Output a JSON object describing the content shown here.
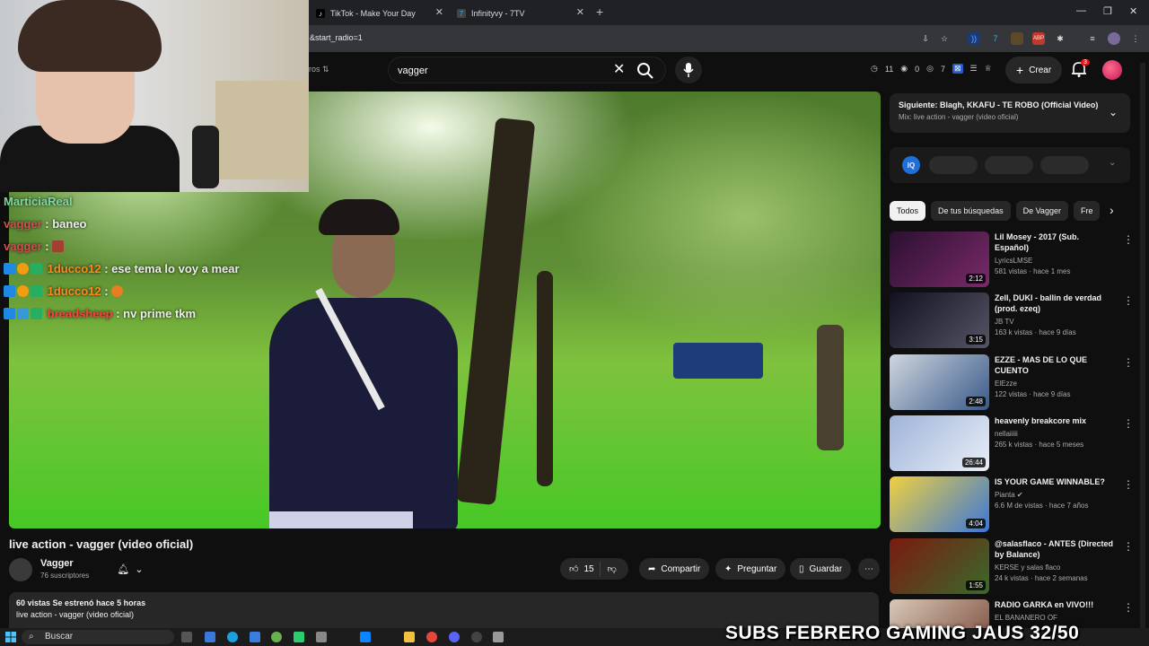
{
  "browser": {
    "tabs": [
      {
        "label": "TikTok - Make Your Day",
        "icon": "tiktok-icon"
      },
      {
        "label": "Infinityvy - 7TV",
        "icon": "7tv-icon"
      }
    ],
    "url": "&start_radio=1"
  },
  "header": {
    "filters_label": "ros",
    "search_value": "vagger",
    "stats": [
      "11",
      "0",
      "7"
    ],
    "create_label": "Crear",
    "notif_count": "3"
  },
  "chat": [
    {
      "user": "MarticiaReal",
      "text": ""
    },
    {
      "user": "vagger",
      "text": ": baneo"
    },
    {
      "user": "vagger",
      "text": ":"
    },
    {
      "user": "1ducco12",
      "text": ": ese tema lo voy a mear"
    },
    {
      "user": "1ducco12",
      "text": ":"
    },
    {
      "user": "breadsheep",
      "text": ": nv prime tkm"
    }
  ],
  "video": {
    "title": "live action - vagger (video oficial)",
    "channel": "Vagger",
    "subs": "76 suscriptores",
    "likes": "15",
    "share_label": "Compartir",
    "ask_label": "Preguntar",
    "save_label": "Guardar",
    "desc_line1": "60 vistas  Se estrenó hace 5 horas",
    "desc_line2": "live action - vagger (video oficial)"
  },
  "next": {
    "title": "Siguiente: Blagh, KKAFU - TE ROBO (Official Video)",
    "subtitle": "Mix: live action - vagger (video oficial)"
  },
  "iq_label": "IQ",
  "chips": [
    "Todos",
    "De tus búsquedas",
    "De Vagger",
    "Fre"
  ],
  "recommendations": [
    {
      "title": "Lil Mosey - 2017 (Sub. Español)",
      "channel": "LyricsLMSE",
      "meta": "581 vistas · hace 1 mes",
      "duration": "2:12",
      "c1": "#2a1030",
      "c2": "#7a2a6a"
    },
    {
      "title": "Zell, DUKI - ballin de verdad (prod. ezeq)",
      "channel": "JB TV",
      "meta": "163 k vistas · hace 9 días",
      "duration": "3:15",
      "c1": "#111122",
      "c2": "#556"
    },
    {
      "title": "EZZE - MAS DE LO QUE CUENTO",
      "channel": "ElEzze",
      "meta": "122 vistas · hace 9 días",
      "duration": "2:48",
      "c1": "#cfd6de",
      "c2": "#3a5a8a"
    },
    {
      "title": "heavenly breakcore mix",
      "channel": "nellaiiiii",
      "meta": "265 k vistas · hace 5 meses",
      "duration": "26:44",
      "c1": "#9fb4d8",
      "c2": "#e8eef8"
    },
    {
      "title": "IS YOUR GAME WINNABLE?",
      "channel": "Pianta",
      "meta": "6.6 M de vistas · hace 7 años",
      "duration": "4:04",
      "c1": "#f0d040",
      "c2": "#3a78d8"
    },
    {
      "title": "@salasflaco - ANTES (Directed by Balance)",
      "channel": "KERSE y salas flaco",
      "meta": "24 k vistas · hace 2 semanas",
      "duration": "1:55",
      "c1": "#7a1a10",
      "c2": "#3a6a2a"
    },
    {
      "title": "RADIO GARKA en VIVO!!!",
      "channel": "EL BANANERO OF",
      "meta": "",
      "duration": "",
      "c1": "#d8c8b8",
      "c2": "#7a4a3a"
    }
  ],
  "taskbar": {
    "search_label": "Buscar"
  },
  "overlay_banner": "SUBS FEBRERO GAMING JAUS 32/50"
}
